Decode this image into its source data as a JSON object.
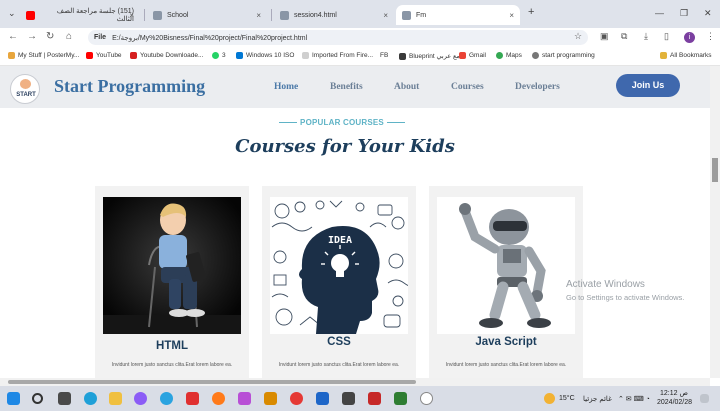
{
  "browser": {
    "tabs": [
      {
        "title": "(151) جلسة مراجعة الصف الثالث",
        "color": "#ff0000"
      },
      {
        "title": "School",
        "color": "#6c7a89"
      },
      {
        "title": "session4.html",
        "color": "#6c7a89"
      },
      {
        "title": "Fm",
        "color": "#6c7a89"
      }
    ],
    "address_scheme": "File",
    "address": "E:/بروجة/My%20Bisness/Final%20project/Final%20project.html",
    "bookmarks": [
      "My Stuff | PosterMy...",
      "YouTube",
      "Youtube Downloade...",
      "Windows 10 ISO",
      "Imported From Fire...",
      "FB",
      "Blueprint مع عربي",
      "Gmail",
      "Maps",
      "start programming"
    ],
    "all_bookmarks": "All Bookmarks",
    "profile_initial": "i"
  },
  "site": {
    "logo_word": "START",
    "title": "Start Programming",
    "nav": [
      "Home",
      "Benefits",
      "About",
      "Courses",
      "Developers"
    ],
    "cta": "Join Us",
    "section_tag": "POPULAR COURSES",
    "section_title": "Courses for Your Kids",
    "courses": [
      {
        "name": "HTML",
        "desc": "Invidunt lorem justo sanctus clita.Erat lorem labore ea."
      },
      {
        "name": "CSS",
        "desc": "Invidunt lorem justo sanctus clita.Erat lorem labore ea."
      },
      {
        "name": "Java Script",
        "desc": "Invidunt lorem justo sanctus clita.Erat lorem labore ea."
      }
    ],
    "css_idea": "IDEA"
  },
  "overlay": {
    "activate_title": "Activate Windows",
    "activate_sub": "Go to Settings to activate Windows."
  },
  "taskbar": {
    "temperature": "15°C",
    "weather": "غائم جزئيا",
    "day": "ص",
    "time": "12:12",
    "date": "2024/02/28"
  },
  "colors": {
    "brand_blue": "#3b6fa2",
    "cta_blue": "#3f68ad",
    "heading_navy": "#1d3e5c",
    "tag_teal": "#5fb3c6"
  }
}
